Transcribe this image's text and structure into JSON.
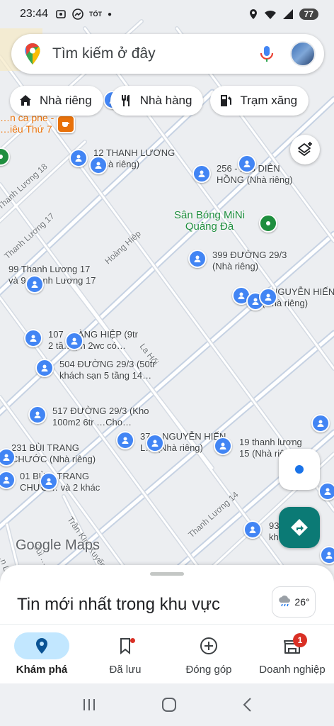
{
  "status_bar": {
    "time": "23:44",
    "battery": "77"
  },
  "search": {
    "placeholder": "Tìm kiếm ở đây"
  },
  "chips": [
    {
      "label": "Nhà riêng",
      "icon": "home-icon"
    },
    {
      "label": "Nhà hàng",
      "icon": "restaurant-icon"
    },
    {
      "label": "Trạm xăng",
      "icon": "gas-station-icon"
    }
  ],
  "map": {
    "places": [
      {
        "name": "12 THANH LƯƠNG",
        "sub": "(Nhà riêng)"
      },
      {
        "name": "256 - 258 DIÊN",
        "sub": "HỒNG (Nhà riêng)"
      },
      {
        "name": "Sân Bóng MiNi",
        "sub": "Quảng Đà"
      },
      {
        "name": "399 ĐƯỜNG 29/3",
        "sub": "(Nhà riêng)"
      },
      {
        "name": "99 Thanh Lương 17",
        "sub": "và 9… anh Lương 17"
      },
      {
        "name": "…NGUYỄN HIẾN",
        "sub": "(Nhà riêng)"
      },
      {
        "name": "107 … ÀNG HIỆP (9tr",
        "sub": "2 tầ… pn 2wc có…"
      },
      {
        "name": "504 ĐƯỜNG 29/3 (50tr",
        "sub": "khách sạn 5 tầng 14…"
      },
      {
        "name": "517 ĐƯỜNG 29/3 (Kho",
        "sub": "100m2 6tr …Cho…"
      },
      {
        "name": "231 BÙI TRANG",
        "sub": "CHƯỚC (Nhà riêng)"
      },
      {
        "name": "37… NGUYỄN HIẾN",
        "sub": "L… (Nhà riêng)"
      },
      {
        "name": "19 thanh lương",
        "sub": "15 (Nhà riê…"
      },
      {
        "name": "01 BÙ… TRANG",
        "sub": "CHƯỚ… và 2 khác"
      },
      {
        "name": "93…",
        "sub": "kh…"
      },
      {
        "name": "…n cà phê -",
        "sub": "…iêu Thứ 7"
      }
    ],
    "streets": [
      "Hoàng Hiệp",
      "Thanh Lương 17",
      "Thanh Lương 18",
      "La Hối",
      "Thanh Lương 14",
      "Trần Kim Xuyến",
      "Bùi …",
      "…n Lê"
    ],
    "logo": "Google Maps"
  },
  "sheet": {
    "title": "Tin mới nhất trong khu vực",
    "weather": "26°"
  },
  "nav": [
    {
      "label": "Khám phá",
      "active": true
    },
    {
      "label": "Đã lưu",
      "active": false
    },
    {
      "label": "Đóng góp",
      "active": false
    },
    {
      "label": "Doanh nghiệp",
      "active": false,
      "badge": "1"
    }
  ],
  "colors": {
    "accent": "#0b7a75",
    "pin": "#4285f4",
    "park": "#1e8e3e"
  }
}
